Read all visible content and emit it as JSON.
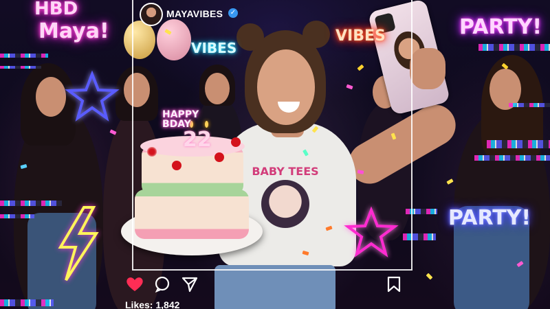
{
  "post": {
    "username": "MAYAVIBES",
    "verified_glyph": "✓",
    "likes_text": "Likes: 1,842",
    "actions": [
      {
        "name": "like",
        "icon": "heart-icon",
        "color": "#ff2d55"
      },
      {
        "name": "comment",
        "icon": "comment-icon"
      },
      {
        "name": "share",
        "icon": "send-icon"
      },
      {
        "name": "save",
        "icon": "bookmark-icon"
      }
    ]
  },
  "neon_signs": {
    "hbd_line1": "HBD",
    "hbd_line2": "Maya!",
    "vibes_orange": "VIBES",
    "vibes_cyan": "VIBES",
    "party_top": "PARTY!",
    "party_bottom": "PARTY!"
  },
  "cake": {
    "topper_line1": "HAPPY",
    "topper_line2": "BDAY",
    "candles": "22"
  },
  "shirt_text": "BABY TEES",
  "colors": {
    "neon_pink": "#ff2bd0",
    "neon_cyan": "#18c8ff",
    "neon_orange": "#ff3b1f",
    "neon_purple": "#5a5cff",
    "like_red": "#ff2d55",
    "verified_blue": "#3897f0"
  }
}
